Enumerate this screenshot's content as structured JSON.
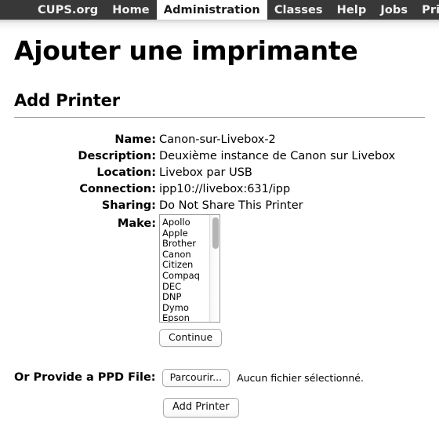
{
  "navbar": {
    "items": [
      {
        "label": "CUPS.org",
        "active": false
      },
      {
        "label": "Home",
        "active": false
      },
      {
        "label": "Administration",
        "active": true
      },
      {
        "label": "Classes",
        "active": false
      },
      {
        "label": "Help",
        "active": false
      },
      {
        "label": "Jobs",
        "active": false
      },
      {
        "label": "Print",
        "active": false
      }
    ]
  },
  "page": {
    "title": "Ajouter une imprimante",
    "section_title": "Add Printer"
  },
  "form": {
    "rows": [
      {
        "label": "Name:",
        "value": "Canon-sur-Livebox-2"
      },
      {
        "label": "Description:",
        "value": "Deuxième instance de Canon sur Livebox"
      },
      {
        "label": "Location:",
        "value": "Livebox par USB"
      },
      {
        "label": "Connection:",
        "value": "ipp10://livebox:631/ipp"
      },
      {
        "label": "Sharing:",
        "value": "Do Not Share This Printer"
      }
    ],
    "make_label": "Make:",
    "make_options": [
      "Apollo",
      "Apple",
      "Brother",
      "Canon",
      "Citizen",
      "Compaq",
      "DEC",
      "DNP",
      "Dymo",
      "Epson"
    ],
    "continue_label": "Continue"
  },
  "ppd": {
    "label": "Or Provide a PPD File:",
    "browse_label": "Parcourir...",
    "file_status": "Aucun fichier sélectionné.",
    "submit_label": "Add Printer"
  },
  "colors": {
    "navbar_background": "#383838",
    "navbar_text": "#f2f2f2",
    "navbar_active_background": "#ffffff",
    "navbar_active_text": "#1a1a1a",
    "page_background": "#ffffff",
    "rule": "#999999",
    "listbox_border": "#9a9a9a",
    "scroll_thumb": "#b4b4b4"
  }
}
